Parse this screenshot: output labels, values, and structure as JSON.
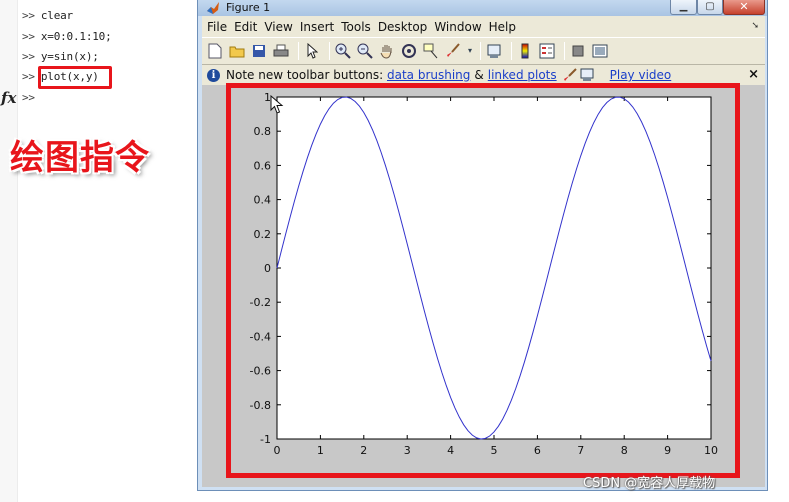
{
  "command_window": {
    "prompt": ">>",
    "lines": [
      "clear",
      "x=0:0.1:10;",
      "y=sin(x);",
      "plot(x,y)"
    ],
    "fx": "fx",
    "annotation": "绘图指令"
  },
  "figure": {
    "title": "Figure 1",
    "menu": [
      "File",
      "Edit",
      "View",
      "Insert",
      "Tools",
      "Desktop",
      "Window",
      "Help"
    ],
    "toolbar_icons": [
      "new-file-icon",
      "open-folder-icon",
      "save-icon",
      "print-icon",
      "pointer-icon",
      "zoom-in-icon",
      "zoom-out-icon",
      "pan-icon",
      "rotate-icon",
      "data-cursor-icon",
      "brush-icon",
      "link-plot-icon",
      "colorbar-icon",
      "legend-icon",
      "hide-tools-icon",
      "show-tools-icon"
    ],
    "info": {
      "text": "Note new toolbar buttons:",
      "link1": "data brushing",
      "amp": "&",
      "link2": "linked plots",
      "link3": "Play video",
      "close": "×"
    }
  },
  "chart_data": {
    "type": "line",
    "x": [
      0,
      0.1,
      0.2,
      0.3,
      0.4,
      0.5,
      0.6,
      0.7,
      0.8,
      0.9,
      1,
      1.1,
      1.2,
      1.3,
      1.4,
      1.5,
      1.6,
      1.7,
      1.8,
      1.9,
      2,
      2.1,
      2.2,
      2.3,
      2.4,
      2.5,
      2.6,
      2.7,
      2.8,
      2.9,
      3,
      3.1,
      3.2,
      3.3,
      3.4,
      3.5,
      3.6,
      3.7,
      3.8,
      3.9,
      4,
      4.1,
      4.2,
      4.3,
      4.4,
      4.5,
      4.6,
      4.7,
      4.8,
      4.9,
      5,
      5.1,
      5.2,
      5.3,
      5.4,
      5.5,
      5.6,
      5.7,
      5.8,
      5.9,
      6,
      6.1,
      6.2,
      6.3,
      6.4,
      6.5,
      6.6,
      6.7,
      6.8,
      6.9,
      7,
      7.1,
      7.2,
      7.3,
      7.4,
      7.5,
      7.6,
      7.7,
      7.8,
      7.9,
      8,
      8.1,
      8.2,
      8.3,
      8.4,
      8.5,
      8.6,
      8.7,
      8.8,
      8.9,
      9,
      9.1,
      9.2,
      9.3,
      9.4,
      9.5,
      9.6,
      9.7,
      9.8,
      9.9,
      10
    ],
    "series": [
      {
        "values": [
          0,
          0.0998,
          0.1987,
          0.2955,
          0.3894,
          0.4794,
          0.5646,
          0.6442,
          0.7174,
          0.7833,
          0.8415,
          0.8912,
          0.932,
          0.9636,
          0.9854,
          0.9975,
          0.9996,
          0.9917,
          0.9738,
          0.9463,
          0.9093,
          0.8632,
          0.8085,
          0.7457,
          0.6755,
          0.5985,
          0.5155,
          0.4274,
          0.335,
          0.2392,
          0.1411,
          0.0416,
          -0.0584,
          -0.1577,
          -0.2555,
          -0.3508,
          -0.4425,
          -0.5298,
          -0.6119,
          -0.6878,
          -0.7568,
          -0.8183,
          -0.8716,
          -0.9162,
          -0.9516,
          -0.9775,
          -0.9937,
          -0.9999,
          -0.9962,
          -0.9825,
          -0.9589,
          -0.9258,
          -0.8835,
          -0.8323,
          -0.7728,
          -0.7055,
          -0.6313,
          -0.5507,
          -0.4646,
          -0.3739,
          -0.2794,
          -0.1822,
          -0.0831,
          0.0168,
          0.1165,
          0.2151,
          0.3115,
          0.4048,
          0.4941,
          0.5784,
          0.657,
          0.729,
          0.7937,
          0.8504,
          0.8987,
          0.938,
          0.9679,
          0.9882,
          0.9985,
          0.9989,
          0.9894,
          0.9699,
          0.9407,
          0.9022,
          0.8546,
          0.7985,
          0.7344,
          0.663,
          0.5849,
          0.501,
          0.4121,
          0.319,
          0.2229,
          0.1245,
          0.0248,
          -0.0752,
          -0.1743,
          -0.2718,
          -0.3665,
          -0.4575,
          -0.544
        ],
        "color": "#3333cc"
      }
    ],
    "xlim": [
      0,
      10
    ],
    "ylim": [
      -1,
      1
    ],
    "xticks": [
      "0",
      "1",
      "2",
      "3",
      "4",
      "5",
      "6",
      "7",
      "8",
      "9",
      "10"
    ],
    "yticks": [
      "-1",
      "-0.8",
      "-0.6",
      "-0.4",
      "-0.2",
      "0",
      "0.2",
      "0.4",
      "0.6",
      "0.8",
      "1"
    ],
    "grid": false,
    "axes_color": "#ffffff",
    "figure_color": "#c8c8c8"
  },
  "highlight_color": "#e8151b",
  "watermark": "CSDN @宽容人厚载物"
}
